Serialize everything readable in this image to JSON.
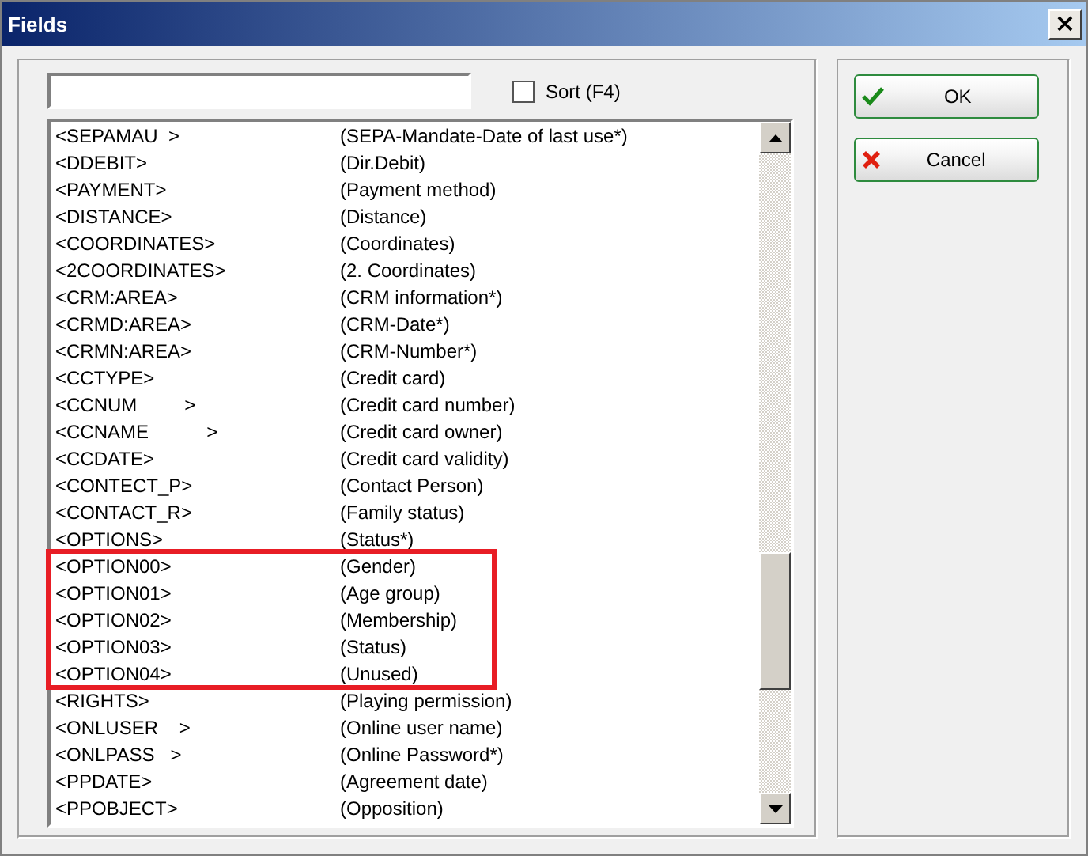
{
  "window": {
    "title": "Fields",
    "close": "×"
  },
  "sort": {
    "label": "Sort (F4)",
    "checked": false
  },
  "rows": [
    {
      "field": "<SEPAMAU  >",
      "description": "(SEPA-Mandate-Date of last use*)",
      "highlighted": false
    },
    {
      "field": "<DDEBIT>",
      "description": "(Dir.Debit)",
      "highlighted": false
    },
    {
      "field": "<PAYMENT>",
      "description": "(Payment method)",
      "highlighted": false
    },
    {
      "field": "<DISTANCE>",
      "description": "(Distance)",
      "highlighted": false
    },
    {
      "field": "<COORDINATES>",
      "description": "(Coordinates)",
      "highlighted": false
    },
    {
      "field": "<2COORDINATES>",
      "description": "(2. Coordinates)",
      "highlighted": false
    },
    {
      "field": "<CRM:AREA>",
      "description": "(CRM information*)",
      "highlighted": false
    },
    {
      "field": "<CRMD:AREA>",
      "description": "(CRM-Date*)",
      "highlighted": false
    },
    {
      "field": "<CRMN:AREA>",
      "description": "(CRM-Number*)",
      "highlighted": false
    },
    {
      "field": "<CCTYPE>",
      "description": "(Credit card)",
      "highlighted": false
    },
    {
      "field": "<CCNUM         >",
      "description": "(Credit card number)",
      "highlighted": false
    },
    {
      "field": "<CCNAME           >",
      "description": "(Credit card owner)",
      "highlighted": false
    },
    {
      "field": "<CCDATE>",
      "description": "(Credit card validity)",
      "highlighted": false
    },
    {
      "field": "<CONTECT_P>",
      "description": "(Contact Person)",
      "highlighted": false
    },
    {
      "field": "<CONTACT_R>",
      "description": "(Family status)",
      "highlighted": false
    },
    {
      "field": "<OPTIONS>",
      "description": "(Status*)",
      "highlighted": false
    },
    {
      "field": "<OPTION00>",
      "description": "(Gender)",
      "highlighted": true
    },
    {
      "field": "<OPTION01>",
      "description": "(Age group)",
      "highlighted": true
    },
    {
      "field": "<OPTION02>",
      "description": "(Membership)",
      "highlighted": true
    },
    {
      "field": "<OPTION03>",
      "description": "(Status)",
      "highlighted": true
    },
    {
      "field": "<OPTION04>",
      "description": "(Unused)",
      "highlighted": true
    },
    {
      "field": "<RIGHTS>",
      "description": "(Playing permission)",
      "highlighted": false
    },
    {
      "field": "<ONLUSER    >",
      "description": "(Online user name)",
      "highlighted": false
    },
    {
      "field": "<ONLPASS   >",
      "description": "(Online Password*)",
      "highlighted": false
    },
    {
      "field": "<PPDATE>",
      "description": "(Agreement date)",
      "highlighted": false
    },
    {
      "field": "<PPOBJECT>",
      "description": "(Opposition)",
      "highlighted": false
    }
  ],
  "buttons": [
    {
      "label": "OK",
      "kind": "ok"
    },
    {
      "label": "Cancel",
      "kind": "cancel"
    }
  ]
}
